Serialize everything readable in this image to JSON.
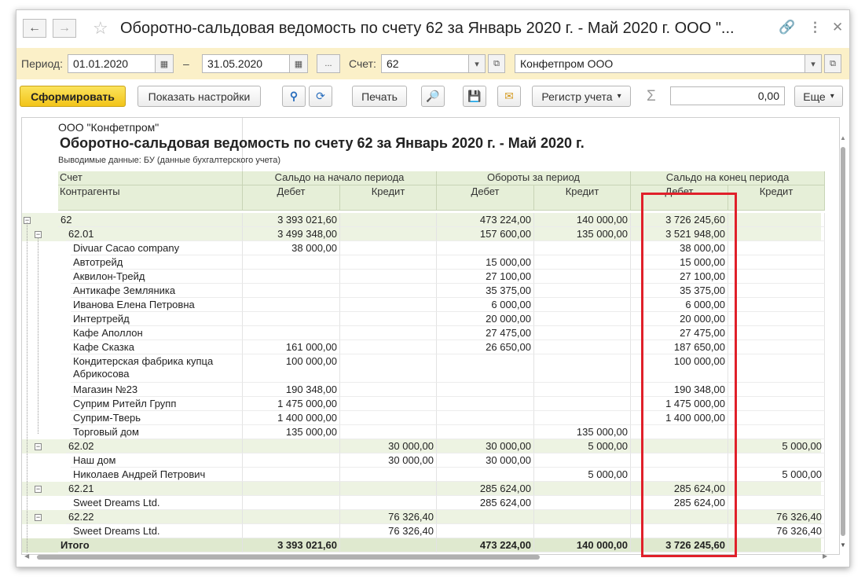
{
  "window": {
    "title": "Оборотно-сальдовая ведомость по счету 62 за Январь 2020 г. - Май 2020 г. ООО \"..."
  },
  "params": {
    "period_label": "Период:",
    "date_from": "01.01.2020",
    "dash": "–",
    "date_to": "31.05.2020",
    "more": "...",
    "account_label": "Счет:",
    "account": "62",
    "org": "Конфетпром ООО"
  },
  "toolbar": {
    "generate": "Сформировать",
    "show_settings": "Показать настройки",
    "print": "Печать",
    "ledger": "Регистр учета",
    "sum_symbol": "Σ",
    "sum_value": "0,00",
    "more": "Еще"
  },
  "report": {
    "org": "ООО \"Конфетпром\"",
    "title": "Оборотно-сальдовая ведомость по счету 62 за Январь 2020 г. - Май 2020 г.",
    "visible_data": "Выводимые данные:  БУ (данные бухгалтерского учета)",
    "headers": {
      "account": "Счет",
      "counterparties": "Контрагенты",
      "opening": "Сальдо на начало периода",
      "turnover": "Обороты за период",
      "closing": "Сальдо на конец периода",
      "debit": "Дебет",
      "credit": "Кредит"
    },
    "rows": [
      {
        "name": "62",
        "type": "grp",
        "level": 0,
        "od": "3 393 021,60",
        "oc": "",
        "td": "473 224,00",
        "tc": "140 000,00",
        "cd": "3 726 245,60",
        "cc": ""
      },
      {
        "name": "62.01",
        "type": "grp",
        "level": 1,
        "od": "3 499 348,00",
        "oc": "",
        "td": "157 600,00",
        "tc": "135 000,00",
        "cd": "3 521 948,00",
        "cc": ""
      },
      {
        "name": "Divuar Cacao company",
        "type": "item",
        "od": "38 000,00",
        "oc": "",
        "td": "",
        "tc": "",
        "cd": "38 000,00",
        "cc": ""
      },
      {
        "name": "Автотрейд",
        "type": "item",
        "od": "",
        "oc": "",
        "td": "15 000,00",
        "tc": "",
        "cd": "15 000,00",
        "cc": ""
      },
      {
        "name": "Аквилон-Трейд",
        "type": "item",
        "od": "",
        "oc": "",
        "td": "27 100,00",
        "tc": "",
        "cd": "27 100,00",
        "cc": ""
      },
      {
        "name": "Антикафе Земляника",
        "type": "item",
        "od": "",
        "oc": "",
        "td": "35 375,00",
        "tc": "",
        "cd": "35 375,00",
        "cc": ""
      },
      {
        "name": "Иванова Елена Петровна",
        "type": "item",
        "od": "",
        "oc": "",
        "td": "6 000,00",
        "tc": "",
        "cd": "6 000,00",
        "cc": ""
      },
      {
        "name": "Интертрейд",
        "type": "item",
        "od": "",
        "oc": "",
        "td": "20 000,00",
        "tc": "",
        "cd": "20 000,00",
        "cc": ""
      },
      {
        "name": "Кафе Аполлон",
        "type": "item",
        "od": "",
        "oc": "",
        "td": "27 475,00",
        "tc": "",
        "cd": "27 475,00",
        "cc": ""
      },
      {
        "name": "Кафе Сказка",
        "type": "item",
        "od": "161 000,00",
        "oc": "",
        "td": "26 650,00",
        "tc": "",
        "cd": "187 650,00",
        "cc": ""
      },
      {
        "name": "Кондитерская фабрика купца",
        "name2": "Абрикосова",
        "type": "item2",
        "od": "100 000,00",
        "oc": "",
        "td": "",
        "tc": "",
        "cd": "100 000,00",
        "cc": ""
      },
      {
        "name": "Магазин №23",
        "type": "item",
        "od": "190 348,00",
        "oc": "",
        "td": "",
        "tc": "",
        "cd": "190 348,00",
        "cc": ""
      },
      {
        "name": "Суприм Ритейл Групп",
        "type": "item",
        "od": "1 475 000,00",
        "oc": "",
        "td": "",
        "tc": "",
        "cd": "1 475 000,00",
        "cc": ""
      },
      {
        "name": "Суприм-Тверь",
        "type": "item",
        "od": "1 400 000,00",
        "oc": "",
        "td": "",
        "tc": "",
        "cd": "1 400 000,00",
        "cc": ""
      },
      {
        "name": "Торговый дом",
        "type": "item",
        "od": "135 000,00",
        "oc": "",
        "td": "",
        "tc": "135 000,00",
        "cd": "",
        "cc": ""
      },
      {
        "name": "62.02",
        "type": "grp",
        "level": 1,
        "od": "",
        "oc": "30 000,00",
        "td": "30 000,00",
        "tc": "5 000,00",
        "cd": "",
        "cc": "5 000,00"
      },
      {
        "name": "Наш дом",
        "type": "item",
        "od": "",
        "oc": "30 000,00",
        "td": "30 000,00",
        "tc": "",
        "cd": "",
        "cc": ""
      },
      {
        "name": "Николаев Андрей Петрович",
        "type": "item",
        "od": "",
        "oc": "",
        "td": "",
        "tc": "5 000,00",
        "cd": "",
        "cc": "5 000,00"
      },
      {
        "name": "62.21",
        "type": "grp",
        "level": 1,
        "od": "",
        "oc": "",
        "td": "285 624,00",
        "tc": "",
        "cd": "285 624,00",
        "cc": ""
      },
      {
        "name": "Sweet Dreams Ltd.",
        "type": "item",
        "od": "",
        "oc": "",
        "td": "285 624,00",
        "tc": "",
        "cd": "285 624,00",
        "cc": ""
      },
      {
        "name": "62.22",
        "type": "grp",
        "level": 1,
        "od": "",
        "oc": "76 326,40",
        "td": "",
        "tc": "",
        "cd": "",
        "cc": "76 326,40"
      },
      {
        "name": "Sweet Dreams Ltd.",
        "type": "item",
        "od": "",
        "oc": "76 326,40",
        "td": "",
        "tc": "",
        "cd": "",
        "cc": "76 326,40"
      },
      {
        "name": "Итого",
        "type": "total",
        "od": "3 393 021,60",
        "oc": "",
        "td": "473 224,00",
        "tc": "140 000,00",
        "cd": "3 726 245,60",
        "cc": ""
      }
    ]
  }
}
